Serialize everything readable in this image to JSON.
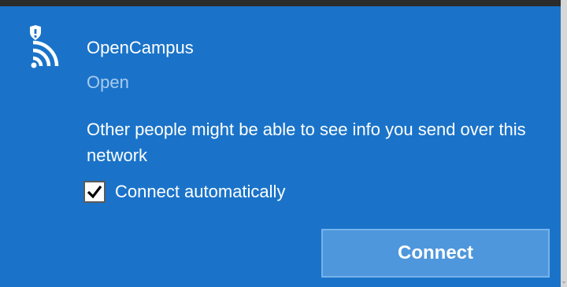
{
  "network": {
    "name": "OpenCampus",
    "status": "Open",
    "warning": "Other people might be able to see info you send over this network",
    "icon": "wifi-shield-icon"
  },
  "auto_connect": {
    "label": "Connect automatically",
    "checked": true
  },
  "actions": {
    "connect_label": "Connect"
  },
  "colors": {
    "panel_background": "#1a73c9",
    "button_background": "#4e97dc",
    "status_text": "#a9cbef",
    "text": "#ffffff"
  }
}
